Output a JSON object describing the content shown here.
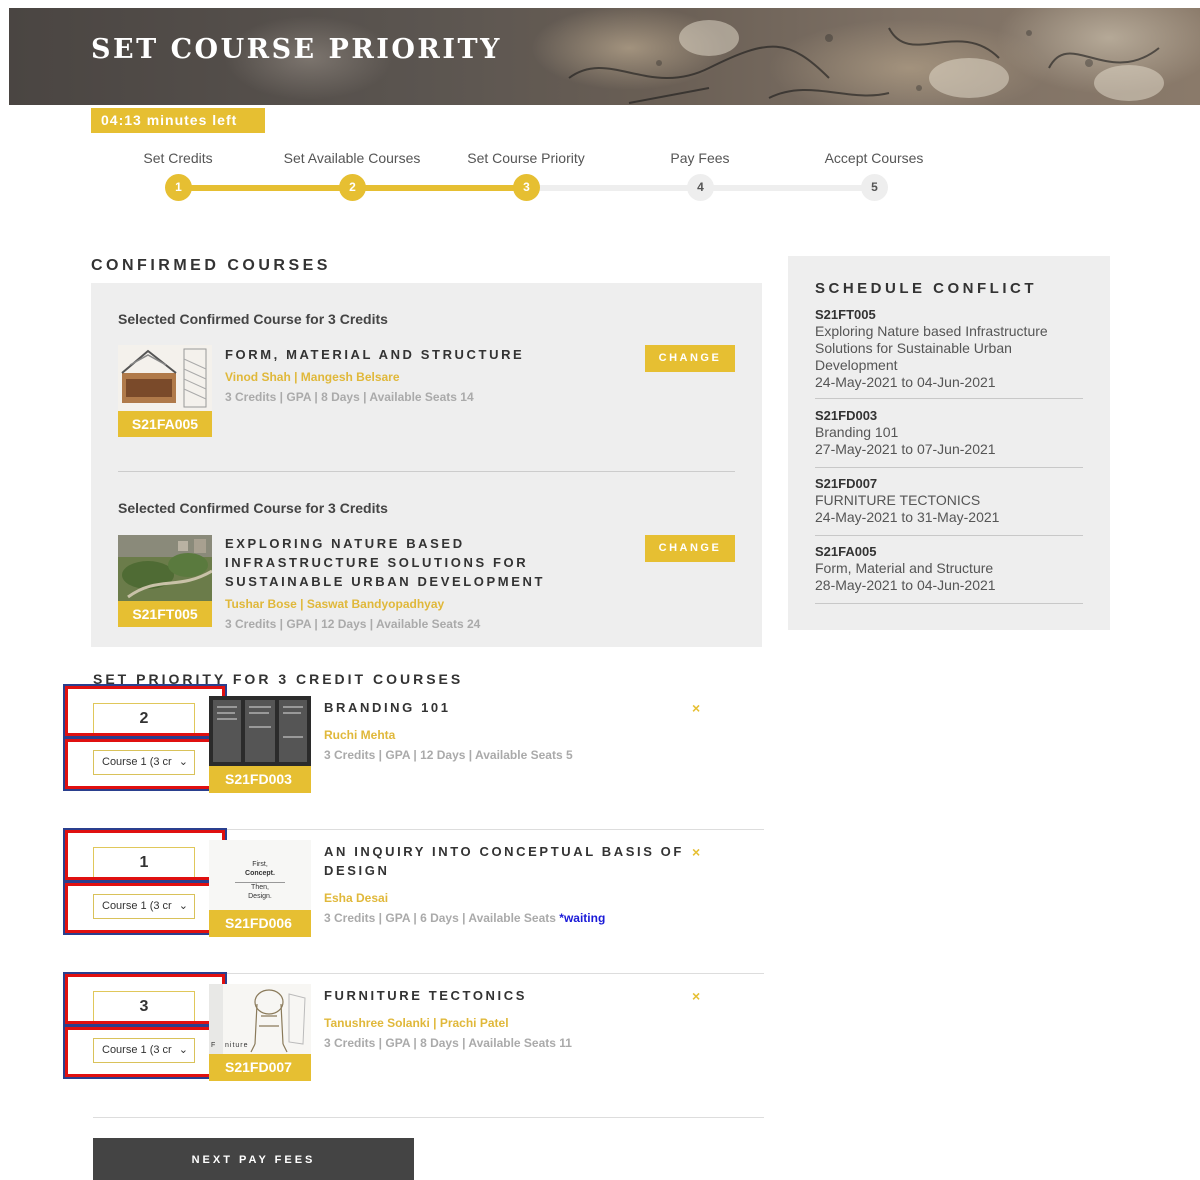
{
  "page": {
    "title": "SET COURSE PRIORITY",
    "timer": "04:13 minutes left"
  },
  "stepper": [
    {
      "label": "Set Credits",
      "number": "1",
      "state": "done"
    },
    {
      "label": "Set Available Courses",
      "number": "2",
      "state": "done"
    },
    {
      "label": "Set Course Priority",
      "number": "3",
      "state": "current"
    },
    {
      "label": "Pay Fees",
      "number": "4",
      "state": "todo"
    },
    {
      "label": "Accept Courses",
      "number": "5",
      "state": "todo"
    }
  ],
  "confirmed": {
    "heading": "CONFIRMED COURSES",
    "courses": [
      {
        "selected_label": "Selected Confirmed Course for 3 Credits",
        "title": "FORM, MATERIAL AND STRUCTURE",
        "faculty": "Vinod Shah | Mangesh Belsare",
        "meta": "3 Credits | GPA | 8 Days | Available Seats 14",
        "code": "S21FA005",
        "change_label": "CHANGE"
      },
      {
        "selected_label": "Selected Confirmed Course for 3 Credits",
        "title": "EXPLORING NATURE BASED INFRASTRUCTURE SOLUTIONS FOR SUSTAINABLE URBAN DEVELOPMENT",
        "faculty": "Tushar Bose | Saswat Bandyopadhyay",
        "meta": "3 Credits | GPA | 12 Days | Available Seats 24",
        "code": "S21FT005",
        "change_label": "CHANGE"
      }
    ]
  },
  "conflict": {
    "heading": "SCHEDULE CONFLICT",
    "items": [
      {
        "code": "S21FT005",
        "name": "Exploring Nature based Infrastructure Solutions for Sustainable Urban Development",
        "dates": "24-May-2021 to 04-Jun-2021"
      },
      {
        "code": "S21FD003",
        "name": "Branding 101",
        "dates": "27-May-2021 to 07-Jun-2021"
      },
      {
        "code": "S21FD007",
        "name": "FURNITURE TECTONICS",
        "dates": "24-May-2021 to 31-May-2021"
      },
      {
        "code": "S21FA005",
        "name": "Form, Material and Structure",
        "dates": "28-May-2021 to 04-Jun-2021"
      }
    ]
  },
  "priority": {
    "heading": "SET PRIORITY FOR 3 CREDIT COURSES",
    "rows": [
      {
        "priority": "2",
        "select_value": "Course 1 (3 cr",
        "title": "BRANDING 101",
        "faculty": "Ruchi Mehta",
        "meta": "3 Credits | GPA | 12 Days | Available Seats 5",
        "waiting": "",
        "code": "S21FD003",
        "remove": "×"
      },
      {
        "priority": "1",
        "select_value": "Course 1 (3 cr",
        "title": "AN INQUIRY INTO CONCEPTUAL BASIS OF DESIGN",
        "faculty": "Esha Desai",
        "meta": "3 Credits | GPA | 6 Days | Available Seats ",
        "waiting": "*waiting",
        "code": "S21FD006",
        "remove": "×",
        "thumb_text": [
          "First,",
          "Concept.",
          "Then,",
          "Design."
        ]
      },
      {
        "priority": "3",
        "select_value": "Course 1 (3 cr",
        "title": "FURNITURE TECTONICS",
        "faculty": "Tanushree Solanki | Prachi Patel",
        "meta": "3 Credits | GPA | 8 Days | Available Seats 11",
        "waiting": "",
        "code": "S21FD007",
        "remove": "×",
        "thumb_text": [
          "F",
          "niture"
        ]
      }
    ]
  },
  "footer": {
    "next_label": "NEXT PAY FEES"
  },
  "colors": {
    "accent": "#e6bf32",
    "panel": "#eeeeee",
    "highlight": "#e01010",
    "waiting": "#1a1ad8"
  },
  "icons": {
    "dropdown": "chevron-down-icon",
    "remove": "remove-icon"
  }
}
